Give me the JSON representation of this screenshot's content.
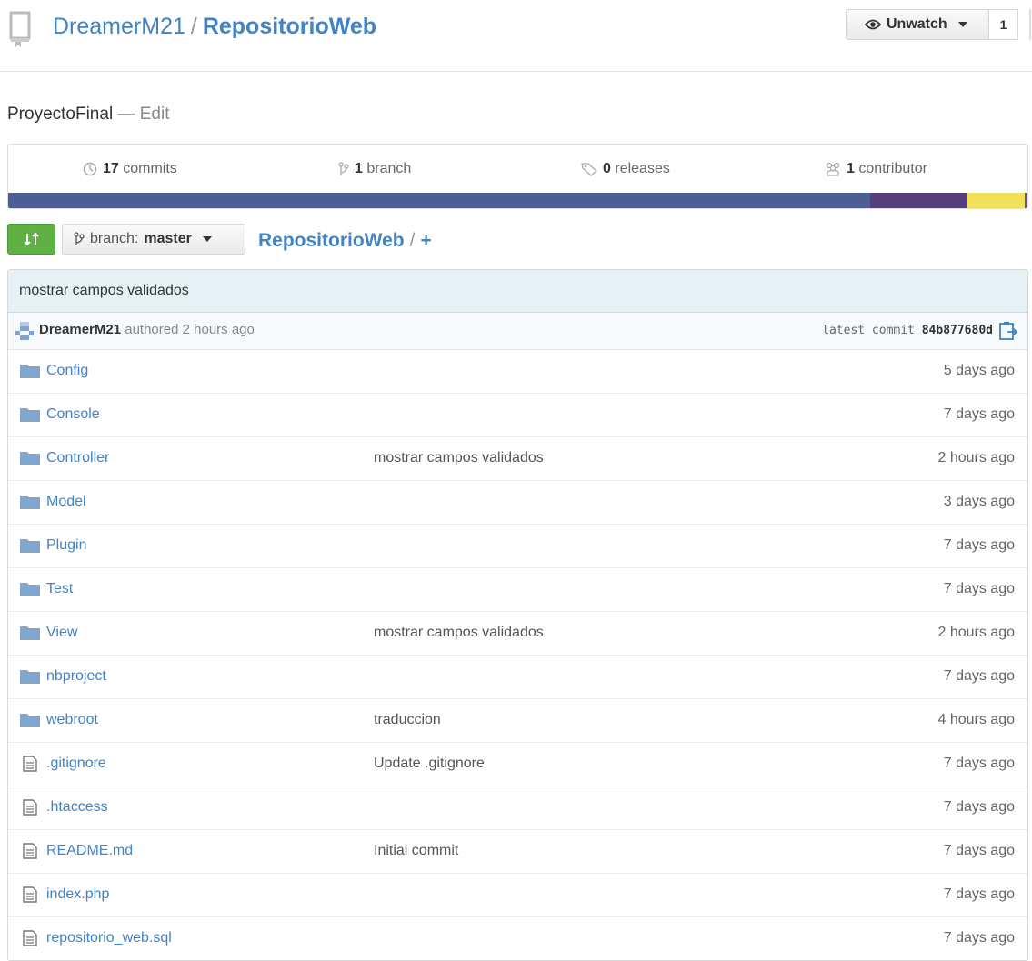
{
  "repo": {
    "owner": "DreamerM21",
    "separator": "/",
    "name": "RepositorioWeb"
  },
  "watch": {
    "label": "Unwatch",
    "count": "1"
  },
  "description": {
    "text": "ProyectoFinal",
    "dash": "—",
    "edit": "Edit"
  },
  "summary": {
    "commits_count": "17",
    "commits_label": "commits",
    "branch_count": "1",
    "branch_label": "branch",
    "releases_count": "0",
    "releases_label": "releases",
    "contributors_count": "1",
    "contributors_label": "contributor"
  },
  "languages": [
    {
      "color": "#4f5d95",
      "percent": 84.6
    },
    {
      "color": "#563d7c",
      "percent": 9.5
    },
    {
      "color": "#f1e05a",
      "percent": 5.6
    },
    {
      "color": "#6e4c99",
      "percent": 0.3
    }
  ],
  "toolbar": {
    "branch_prefix": "branch:",
    "branch_name": "master",
    "crumb_root": "RepositorioWeb",
    "crumb_sep": "/",
    "crumb_plus": "+"
  },
  "commit": {
    "message": "mostrar campos validados",
    "author": "DreamerM21",
    "authored": "authored 2 hours ago",
    "latest_label": "latest commit",
    "sha": "84b877680d"
  },
  "files": [
    {
      "type": "dir",
      "name": "Config",
      "message": "",
      "age": "5 days ago"
    },
    {
      "type": "dir",
      "name": "Console",
      "message": "",
      "age": "7 days ago"
    },
    {
      "type": "dir",
      "name": "Controller",
      "message": "mostrar campos validados",
      "age": "2 hours ago"
    },
    {
      "type": "dir",
      "name": "Model",
      "message": "",
      "age": "3 days ago"
    },
    {
      "type": "dir",
      "name": "Plugin",
      "message": "",
      "age": "7 days ago"
    },
    {
      "type": "dir",
      "name": "Test",
      "message": "",
      "age": "7 days ago"
    },
    {
      "type": "dir",
      "name": "View",
      "message": "mostrar campos validados",
      "age": "2 hours ago"
    },
    {
      "type": "dir",
      "name": "nbproject",
      "message": "",
      "age": "7 days ago"
    },
    {
      "type": "dir",
      "name": "webroot",
      "message": "traduccion",
      "age": "4 hours ago"
    },
    {
      "type": "file",
      "name": ".gitignore",
      "message": "Update .gitignore",
      "age": "7 days ago"
    },
    {
      "type": "file",
      "name": ".htaccess",
      "message": "",
      "age": "7 days ago"
    },
    {
      "type": "file",
      "name": "README.md",
      "message": "Initial commit",
      "age": "7 days ago"
    },
    {
      "type": "file",
      "name": "index.php",
      "message": "",
      "age": "7 days ago"
    },
    {
      "type": "file",
      "name": "repositorio_web.sql",
      "message": "",
      "age": "7 days ago"
    }
  ],
  "icons": {
    "repo": "repo-book-icon",
    "eye": "eye-icon",
    "caret": "caret-down-icon",
    "history": "history-icon",
    "branch": "branch-icon",
    "tag": "tag-icon",
    "organization": "organization-icon",
    "compare": "compare-icon",
    "folder": "folder-icon",
    "file": "file-text-icon",
    "clipboard": "clipboard-icon"
  }
}
